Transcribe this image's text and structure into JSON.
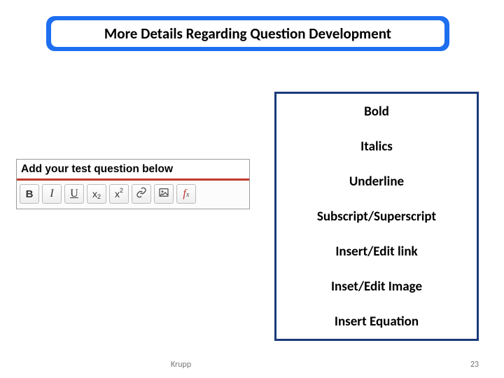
{
  "title": "More Details Regarding Question Development",
  "editor": {
    "header": "Add your test question below",
    "buttons": {
      "bold": "B",
      "italic": "I",
      "underline": "U"
    }
  },
  "features": [
    "Bold",
    "Italics",
    "Underline",
    "Subscript/Superscript",
    "Insert/Edit link",
    "Inset/Edit Image",
    "Insert Equation"
  ],
  "footer": {
    "author": "Krupp",
    "page": "23"
  }
}
